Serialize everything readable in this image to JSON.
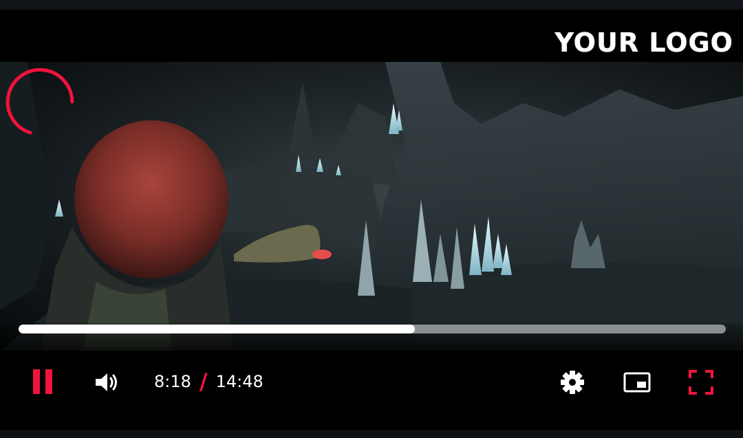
{
  "logo": {
    "text": "YOUR LOGO"
  },
  "player": {
    "state": "playing",
    "current_time": "8:18",
    "separator": "/",
    "duration": "14:48",
    "progress_fraction": 0.56,
    "buffering": true
  },
  "controls": {
    "pause": {
      "icon": "pause-icon"
    },
    "volume": {
      "icon": "speaker-icon"
    },
    "settings": {
      "icon": "gear-icon"
    },
    "miniplayer": {
      "icon": "picture-in-picture-icon"
    },
    "fullscreen": {
      "icon": "fullscreen-icon"
    }
  },
  "colors": {
    "accent": "#f0133d",
    "progress_played": "#ffffff",
    "progress_track": "#8a8f94",
    "icon_light": "#ffffff"
  }
}
